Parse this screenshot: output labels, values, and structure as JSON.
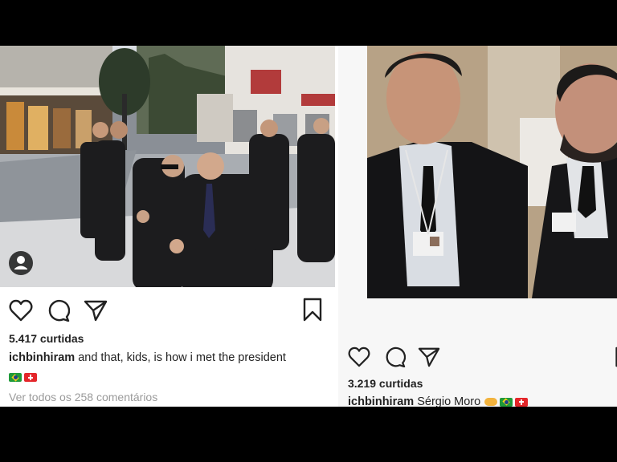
{
  "left_post": {
    "likes": "5.417 curtidas",
    "username": "ichbinhiram",
    "caption": " and that, kids, is how i met the president",
    "emojis": [
      "flag-brazil-icon",
      "flag-switzerland-icon"
    ],
    "comments_link": "Ver todos os 258 comentários"
  },
  "right_post": {
    "likes": "3.219 curtidas",
    "username": "ichbinhiram",
    "caption": " Sérgio Moro",
    "emojis": [
      "handshake-icon",
      "flag-brazil-icon",
      "flag-switzerland-icon"
    ]
  },
  "actions": [
    "heart-icon",
    "comment-icon",
    "share-icon",
    "bookmark-icon"
  ],
  "colors": {
    "background": "#000000",
    "panel": "#ffffff",
    "text": "#222222",
    "muted": "#9a9a9a"
  }
}
